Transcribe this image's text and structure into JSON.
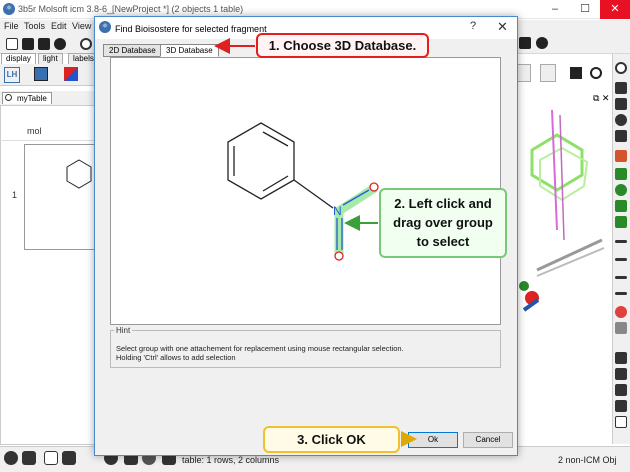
{
  "app": {
    "title": "3b5r Molsoft icm 3.8-6_[NewProject *] (2 objects 1 table)",
    "menu": [
      "File",
      "Tools",
      "Edit",
      "View"
    ],
    "tabs": [
      "display",
      "light",
      "labels"
    ],
    "table_tab": "myTable",
    "table": {
      "column": "mol",
      "row_number": "1"
    },
    "status_text": "table: 1 rows, 2 columns",
    "status_right": "2 non-ICM Obj"
  },
  "dialog": {
    "title": "Find Bioisostere for selected fragment",
    "help_glyph": "?",
    "close_glyph": "✕",
    "tabs": [
      "2D Database",
      "3D Database"
    ],
    "active_tab": "3D Database",
    "molecule": {
      "atoms": [
        "N",
        "O",
        "O"
      ]
    },
    "hint": {
      "label": "Hint",
      "line1": "Select group with one attachement for replacement using mouse rectangular selection.",
      "line2": "Holding 'Ctrl' allows to add selection"
    },
    "buttons": {
      "ok": "Ok",
      "cancel": "Cancel"
    }
  },
  "callouts": {
    "step1": "1. Choose 3D Database.",
    "step2_line1": "2. Left click and",
    "step2_line2": "drag over group",
    "step2_line3": "to select",
    "step3": "3. Click OK"
  },
  "colors": {
    "callout1_border": "#e02020",
    "callout2_border": "#78c878",
    "callout3_border": "#f0c030",
    "nitrogen": "#1f5fd6",
    "oxygen": "#e02020",
    "selection": "#a8e8a8"
  }
}
